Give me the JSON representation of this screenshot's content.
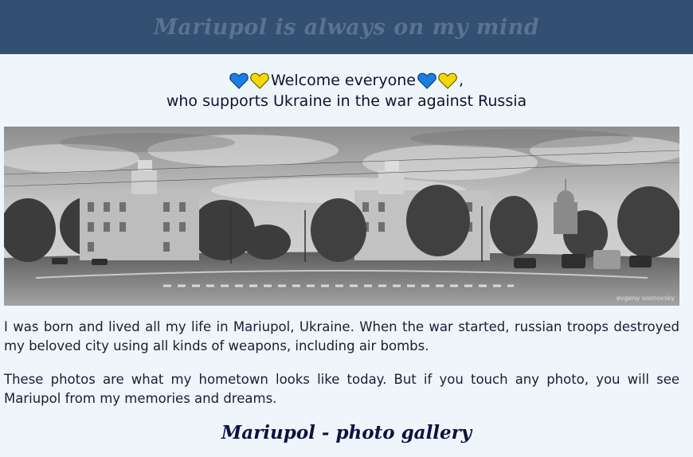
{
  "header": {
    "title": "Mariupol is always on my mind"
  },
  "welcome": {
    "line1_text": "Welcome everyone",
    "line1_suffix": ",",
    "line2": "who supports Ukraine in the war against Russia",
    "heart_colors": {
      "blue": "#1b7fe0",
      "yellow": "#f5d800"
    }
  },
  "photo": {
    "credit": "evgeny sosnovsky",
    "alt": "Panorama of a Mariupol street intersection"
  },
  "paragraphs": [
    "I was born and lived all my life in Mariupol, Ukraine. When the war started, russian troops destroyed my beloved city using all kinds of weapons, including air bombs.",
    "These photos are what my hometown looks like today. But if you touch any photo, you will see Mariupol from my memories and dreams."
  ],
  "gallery": {
    "title": "Mariupol - photo gallery"
  }
}
